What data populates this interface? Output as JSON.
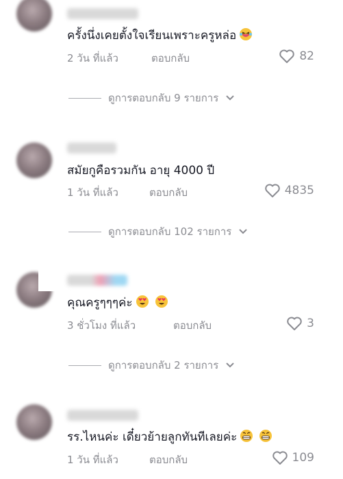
{
  "comments": [
    {
      "text": "ครั้งนึ่งเคยตั้งใจเรียนเพราะครูหล่อ",
      "emoji": "laughing-crying-emoji",
      "time": "2 วัน ที่แล้ว",
      "reply": "ตอบกลับ",
      "likes": "82",
      "view_replies": "ดูการตอบกลับ 9 รายการ"
    },
    {
      "text": "สมัยกูคือรวมกัน อายุ 4000 ปี",
      "time": "1 วัน ที่แล้ว",
      "reply": "ตอบกลับ",
      "likes": "4835",
      "view_replies": "ดูการตอบกลับ 102 รายการ"
    },
    {
      "text": "คุณครูๆๆๆค่ะ",
      "emoji": "heart-eyes-emoji",
      "time": "3 ชั่วโมง ที่แล้ว",
      "reply": "ตอบกลับ",
      "likes": "3",
      "view_replies": "ดูการตอบกลับ 2 รายการ"
    },
    {
      "text": "รร.ไหนค่ะ เดี๋ยวย้ายลูกทันทีเลยค่ะ",
      "emoji": "grinning-emoji",
      "time": "1 วัน ที่แล้ว",
      "reply": "ตอบกลับ",
      "likes": "109"
    }
  ],
  "colors": {
    "text_primary": "#161823",
    "text_secondary": "#8a8b91",
    "background": "#ffffff"
  }
}
